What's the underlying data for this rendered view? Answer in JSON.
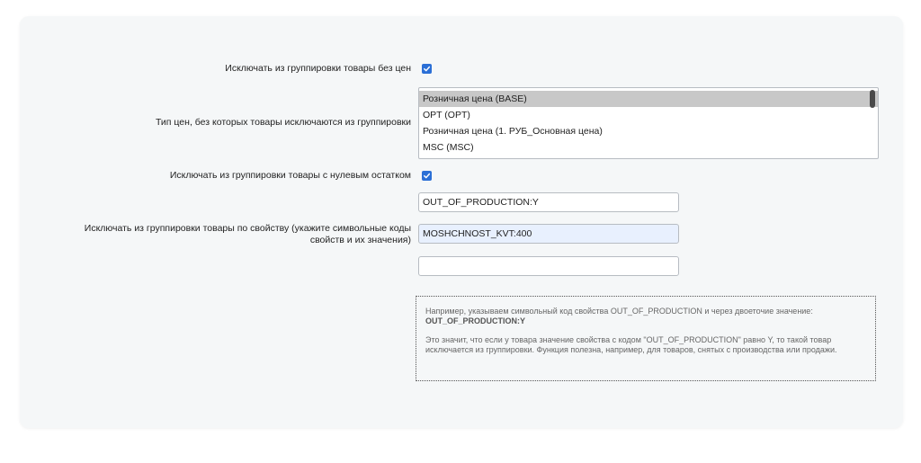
{
  "form": {
    "exclude_no_price": {
      "label": "Исключать из группировки товары без цен",
      "checked": true
    },
    "price_types": {
      "label": "Тип цен, без которых товары исключаются из группировки",
      "options": [
        {
          "label": "Розничная цена (BASE)",
          "selected": true
        },
        {
          "label": "OPT (OPT)",
          "selected": false
        },
        {
          "label": "Розничная цена (1. РУБ_Основная цена)",
          "selected": false
        },
        {
          "label": "MSC (MSC)",
          "selected": false
        }
      ]
    },
    "exclude_zero_stock": {
      "label": "Исключать из группировки товары с нулевым остатком",
      "checked": true
    },
    "exclude_by_property": {
      "label_line1": "Исключать из группировки товары по свойству (укажите символьные коды",
      "label_line2": "свойств и их значения)",
      "values": [
        "OUT_OF_PRODUCTION:Y",
        "MOSHCHNOST_KVT:400",
        ""
      ]
    },
    "hint": {
      "line1": "Например, указываем символьный код свойства OUT_OF_PRODUCTION и через двоеточие значение:",
      "example": "OUT_OF_PRODUCTION:Y",
      "explanation": "Это значит, что если у товара значение свойства с кодом \"OUT_OF_PRODUCTION\" равно Y, то такой товар исключается из группировки. Функция полезна, например, для товаров, снятых с производства или продажи."
    }
  },
  "colors": {
    "checkbox": "#2b6fd6",
    "panel_bg": "#f5f7f8",
    "autofill_bg": "#e8f0fe"
  }
}
